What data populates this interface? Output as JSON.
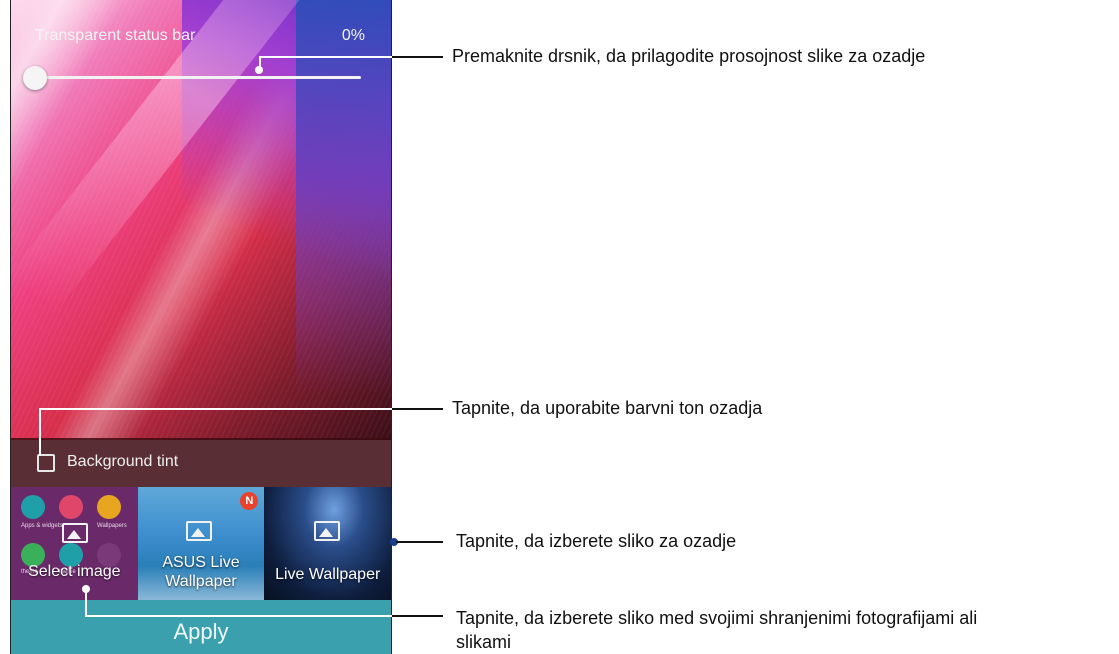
{
  "phone": {
    "transparent_status_bar_label": "Transparent status bar",
    "transparent_status_bar_value": "0%",
    "background_tint_label": "Background tint",
    "thumbnails": [
      {
        "label": "Select image"
      },
      {
        "label_line1": "ASUS Live",
        "label_line2": "Wallpaper",
        "badge": "N"
      },
      {
        "label": "Live Wallpaper"
      }
    ],
    "theme_icons": {
      "apps_widgets": "Apps & widgets",
      "wallpapers": "Wallpapers",
      "theme": "theme"
    },
    "apply_label": "Apply",
    "slider_level_percent": 0
  },
  "callouts": {
    "slider": "Premaknite drsnik, da prilagodite prosojnost slike za ozadje",
    "tint": "Tapnite, da uporabite barvni ton ozadja",
    "select_wallpaper": "Tapnite, da izberete sliko za ozadje",
    "select_image_line1": "Tapnite, da izberete sliko med svojimi shranjenimi fotografijami ali",
    "select_image_line2": "slikami"
  },
  "colors": {
    "apply_button": "#3aa0ad",
    "badge": "#e8432d",
    "callout_line": "#111111"
  }
}
